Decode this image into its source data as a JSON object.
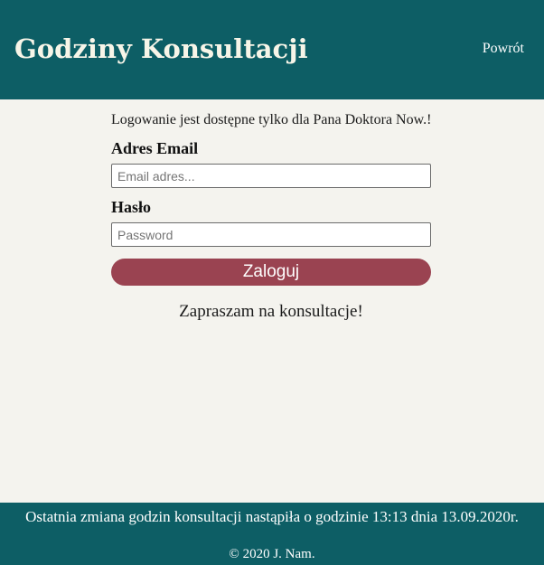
{
  "header": {
    "title": "Godziny Konsultacji",
    "back_link": "Powrót"
  },
  "login": {
    "info": "Logowanie jest dostępne tylko dla Pana Doktora Now.!",
    "email_label": "Adres Email",
    "email_placeholder": "Email adres...",
    "email_value": "",
    "password_label": "Hasło",
    "password_placeholder": "Password",
    "password_value": "",
    "submit_label": "Zaloguj",
    "invite_text": "Zapraszam na konsultacje!"
  },
  "footer": {
    "last_change": "Ostatnia zmiana godzin konsultacji nastąpiła o godzinie 13:13 dnia 13.09.2020r.",
    "copyright": "© 2020 J. Nam."
  },
  "colors": {
    "header_bg": "#0d5e65",
    "page_bg": "#f4f3ee",
    "button_bg": "#9a4351",
    "title_text": "#f7f5e8"
  }
}
